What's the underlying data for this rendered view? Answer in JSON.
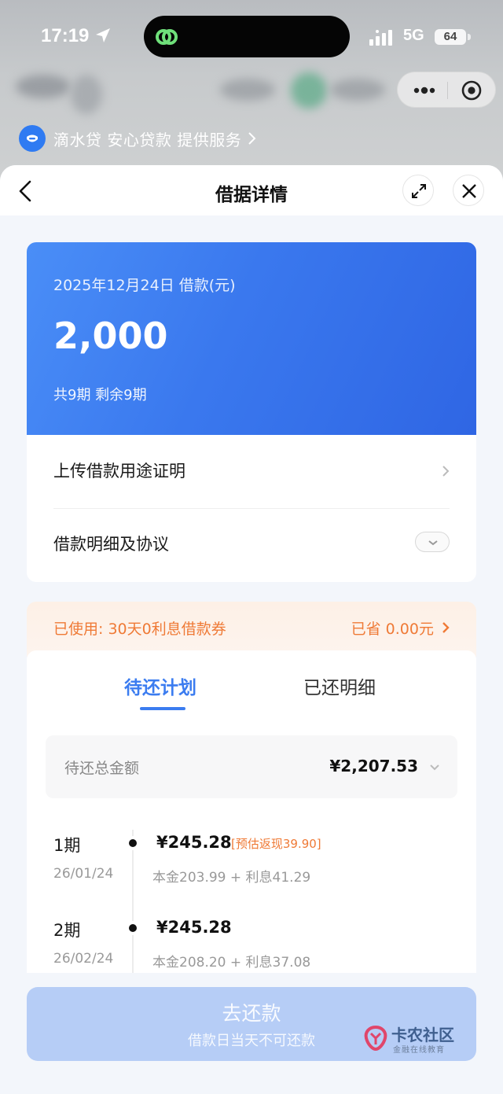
{
  "status_bar": {
    "time": "17:19",
    "network": "5G",
    "battery": "64"
  },
  "provider_bar": {
    "text": "滴水贷 安心贷款 提供服务"
  },
  "header": {
    "title": "借据详情"
  },
  "loan_card": {
    "date_label": "2025年12月24日 借款(元)",
    "amount": "2,000",
    "terms": "共9期  剩余9期"
  },
  "rows": {
    "upload_label": "上传借款用途证明",
    "details_label": "借款明细及协议"
  },
  "coupon": {
    "used_text": "已使用:  30天0利息借款券",
    "saved_text": "已省 0.00元"
  },
  "tabs": {
    "pending": "待还计划",
    "repaid": "已还明细"
  },
  "total": {
    "label": "待还总金额",
    "value": "¥2,207.53"
  },
  "installments": [
    {
      "period": "1期",
      "date": "26/01/24",
      "amount": "¥245.28",
      "cashback": "[预估返现39.90]",
      "detail": "本金203.99 + 利息41.29"
    },
    {
      "period": "2期",
      "date": "26/02/24",
      "amount": "¥245.28",
      "cashback": "",
      "detail": "本金208.20 + 利息37.08"
    }
  ],
  "pay_button": {
    "label": "去还款",
    "sub": "借款日当天不可还款"
  },
  "watermark": {
    "title": "卡农社区",
    "subtitle": "金融在线教育"
  },
  "colors": {
    "accent_blue": "#3b7cf0",
    "coupon_orange": "#ef7a36",
    "pay_button_disabled": "#b6cdf6"
  }
}
